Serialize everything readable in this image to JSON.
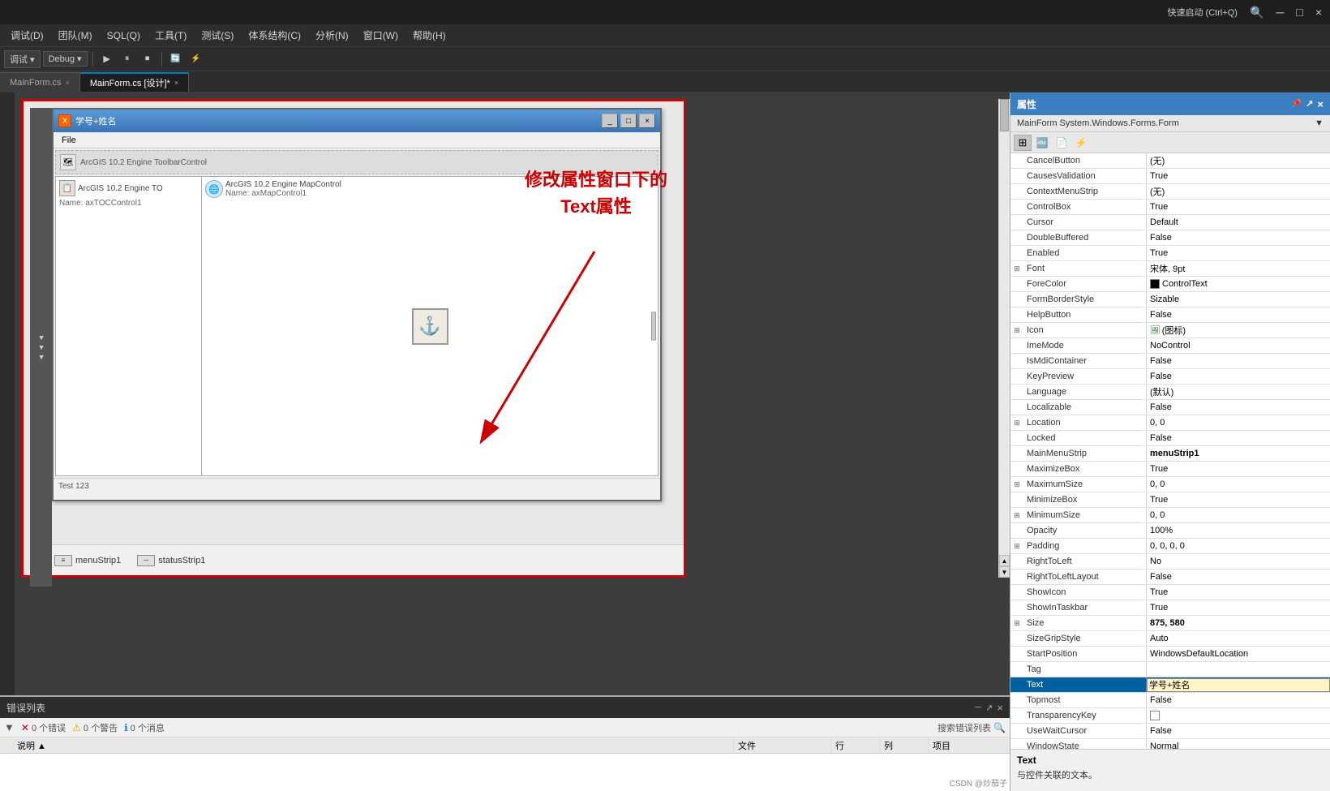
{
  "titlebar": {
    "shortcut": "快速启动 (Ctrl+Q)",
    "minimize": "─",
    "maximize": "□",
    "close": "×"
  },
  "menubar": {
    "items": [
      "调试(D)",
      "团队(M)",
      "SQL(Q)",
      "工具(T)",
      "测试(S)",
      "体系结构(C)",
      "分析(N)",
      "窗口(W)",
      "帮助(H)"
    ]
  },
  "toolbar": {
    "debug_label": "调试",
    "config_label": "Debug"
  },
  "tabs": [
    {
      "label": "MainForm.cs",
      "active": false
    },
    {
      "label": "MainForm.cs [设计]*",
      "active": true
    }
  ],
  "form_window": {
    "title": "学号+姓名",
    "menu_items": [
      "File"
    ],
    "toolbar_control": "ArcGIS 10.2 Engine ToolbarControl",
    "toc_control": "ArcGIS 10.2 Engine TO",
    "toc_name": "Name: axTOCControl1",
    "map_control": "ArcGIS 10.2 Engine MapControl",
    "map_name": "Name: axMapControl1",
    "status_text": "Test 123"
  },
  "annotation": {
    "line1": "修改属性窗口下的",
    "line2": "Text属性"
  },
  "components": [
    {
      "icon": "≡",
      "label": "menuStrip1"
    },
    {
      "icon": "─",
      "label": "statusStrip1"
    }
  ],
  "properties_panel": {
    "title": "属性",
    "object_name": "MainForm System.Windows.Forms.Form",
    "rows": [
      {
        "name": "CancelButton",
        "value": "(无)",
        "group": false,
        "expand": false
      },
      {
        "name": "CausesValidation",
        "value": "True",
        "group": false,
        "expand": false
      },
      {
        "name": "ContextMenuStrip",
        "value": "(无)",
        "group": false,
        "expand": false
      },
      {
        "name": "ControlBox",
        "value": "True",
        "group": false,
        "expand": false
      },
      {
        "name": "Cursor",
        "value": "Default",
        "group": false,
        "expand": false
      },
      {
        "name": "DoubleBuffered",
        "value": "False",
        "group": false,
        "expand": false
      },
      {
        "name": "Enabled",
        "value": "True",
        "group": false,
        "expand": false
      },
      {
        "name": "Font",
        "value": "宋体, 9pt",
        "group": false,
        "expand": true
      },
      {
        "name": "ForeColor",
        "value": "ControlText",
        "group": false,
        "expand": false,
        "color": "#000000",
        "showColor": true
      },
      {
        "name": "FormBorderStyle",
        "value": "Sizable",
        "group": false,
        "expand": false
      },
      {
        "name": "HelpButton",
        "value": "False",
        "group": false,
        "expand": false
      },
      {
        "name": "Icon",
        "value": "🖼 (图标)",
        "group": false,
        "expand": false
      },
      {
        "name": "ImeMode",
        "value": "NoControl",
        "group": false,
        "expand": false
      },
      {
        "name": "IsMdiContainer",
        "value": "False",
        "group": false,
        "expand": false
      },
      {
        "name": "KeyPreview",
        "value": "False",
        "group": false,
        "expand": false
      },
      {
        "name": "Language",
        "value": "(默认)",
        "group": false,
        "expand": false
      },
      {
        "name": "Localizable",
        "value": "False",
        "group": false,
        "expand": false
      },
      {
        "name": "Location",
        "value": "0, 0",
        "group": false,
        "expand": true
      },
      {
        "name": "Locked",
        "value": "False",
        "group": false,
        "expand": false
      },
      {
        "name": "MainMenuStrip",
        "value": "menuStrip1",
        "group": false,
        "expand": false,
        "bold": true
      },
      {
        "name": "MaximizeBox",
        "value": "True",
        "group": false,
        "expand": false
      },
      {
        "name": "MaximumSize",
        "value": "0, 0",
        "group": false,
        "expand": true
      },
      {
        "name": "MinimizeBox",
        "value": "True",
        "group": false,
        "expand": false
      },
      {
        "name": "MinimumSize",
        "value": "0, 0",
        "group": false,
        "expand": true
      },
      {
        "name": "Opacity",
        "value": "100%",
        "group": false,
        "expand": false
      },
      {
        "name": "Padding",
        "value": "0, 0, 0, 0",
        "group": false,
        "expand": true
      },
      {
        "name": "RightToLeft",
        "value": "No",
        "group": false,
        "expand": false
      },
      {
        "name": "RightToLeftLayout",
        "value": "False",
        "group": false,
        "expand": false
      },
      {
        "name": "ShowIcon",
        "value": "True",
        "group": false,
        "expand": false
      },
      {
        "name": "ShowInTaskbar",
        "value": "True",
        "group": false,
        "expand": false
      },
      {
        "name": "Size",
        "value": "875, 580",
        "group": false,
        "expand": true,
        "bold": true
      },
      {
        "name": "SizeGripStyle",
        "value": "Auto",
        "group": false,
        "expand": false
      },
      {
        "name": "StartPosition",
        "value": "WindowsDefaultLocation",
        "group": false,
        "expand": false
      },
      {
        "name": "Tag",
        "value": "",
        "group": false,
        "expand": false
      },
      {
        "name": "Text",
        "value": "学号+姓名",
        "group": false,
        "expand": false,
        "selected": true,
        "editable": true
      },
      {
        "name": "Topmost",
        "value": "False",
        "group": false,
        "expand": false
      },
      {
        "name": "TransparencyKey",
        "value": "",
        "group": false,
        "expand": false,
        "showColor": true,
        "color": "#ffffff"
      },
      {
        "name": "UseWaitCursor",
        "value": "False",
        "group": false,
        "expand": false
      },
      {
        "name": "WindowState",
        "value": "Normal",
        "group": false,
        "expand": false
      }
    ]
  },
  "props_footer": {
    "title": "Text",
    "description": "与控件关联的文本。"
  },
  "error_panel": {
    "title": "错误列表",
    "filters": [
      {
        "icon": "✕",
        "count": "0 个错误"
      },
      {
        "icon": "⚠",
        "count": "0 个警告"
      },
      {
        "icon": "ℹ",
        "count": "0 个消息"
      }
    ],
    "search_placeholder": "搜索错误列表",
    "columns": [
      "说明",
      "文件",
      "行",
      "列",
      "项目"
    ]
  },
  "csdn": {
    "watermark": "CSDN @炒茄子"
  }
}
